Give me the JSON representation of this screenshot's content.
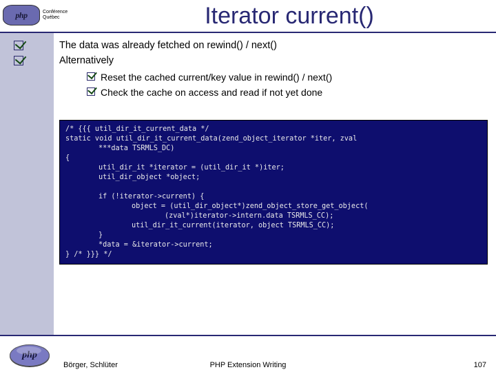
{
  "header": {
    "logo_text": "php",
    "conf_line1": "Conférence",
    "conf_line2": "Québec",
    "title": "Iterator current()"
  },
  "bullets": [
    "The data was already fetched on rewind() / next()",
    "Alternatively"
  ],
  "sub_bullets": [
    "Reset the cached current/key value in rewind() / next()",
    "Check the cache on access and read if not yet done"
  ],
  "code": {
    "l0": "/* {{{ util_dir_it_current_data */",
    "l1": "static void util_dir_it_current_data(zend_object_iterator *iter, zval",
    "l2": "***data TSRMLS_DC)",
    "l3": "{",
    "l4": "util_dir_it *iterator = (util_dir_it *)iter;",
    "l5": "util_dir_object *object;",
    "l6": "",
    "l7": "if (!iterator->current) {",
    "l8": "object = (util_dir_object*)zend_object_store_get_object(",
    "l9": "(zval*)iterator->intern.data TSRMLS_CC);",
    "l10": "util_dir_it_current(iterator, object TSRMLS_CC);",
    "l11": "}",
    "l12": "*data = &iterator->current;",
    "l13": "} /* }}} */"
  },
  "footer": {
    "php": "php",
    "left": "Börger, Schlüter",
    "center": "PHP Extension Writing",
    "right": "107"
  }
}
